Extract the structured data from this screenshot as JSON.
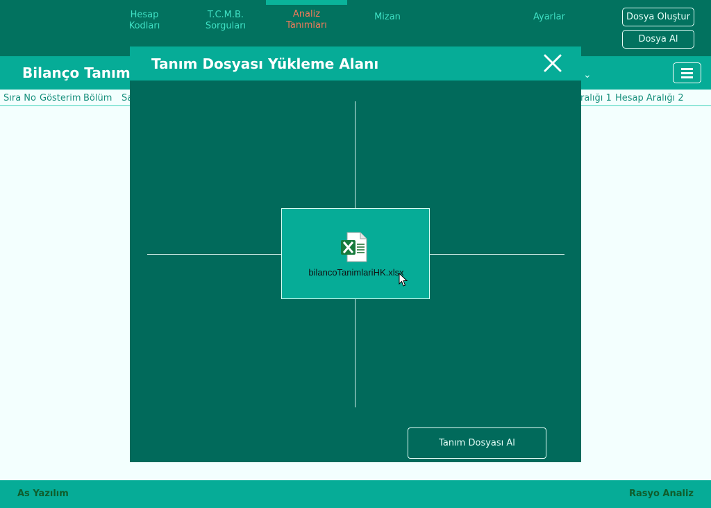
{
  "nav": {
    "items": [
      {
        "line1": "Hesap",
        "line2": "Kodları"
      },
      {
        "line1": "T.C.M.B.",
        "line2": "Sorguları"
      },
      {
        "line1": "Analiz",
        "line2": "Tanımları"
      },
      {
        "line1": "Mizan",
        "line2": ""
      },
      {
        "line1": "Ayarlar",
        "line2": ""
      }
    ],
    "create_file_label": "Dosya Oluştur",
    "get_file_label": "Dosya Al"
  },
  "subheader": {
    "title": "Bilanço Tanımla"
  },
  "columns": {
    "left": [
      "Sıra No",
      "Gösterim",
      "Bölüm",
      "Sa"
    ],
    "right": [
      "ralığı 1",
      "Hesap Aralığı 2"
    ]
  },
  "modal": {
    "title": "Tanım Dosyası Yükleme Alanı",
    "file_name": "bilancoTanimlariHK.xlsx",
    "get_button_label": "Tanım Dosyası Al"
  },
  "footer": {
    "left": "As Yazılım",
    "right": "Rasyo Analiz"
  },
  "colors": {
    "primary_dark": "#02725f",
    "primary": "#06ac97",
    "modal_body": "#016a5b",
    "footer_text": "#0f5d2c"
  }
}
